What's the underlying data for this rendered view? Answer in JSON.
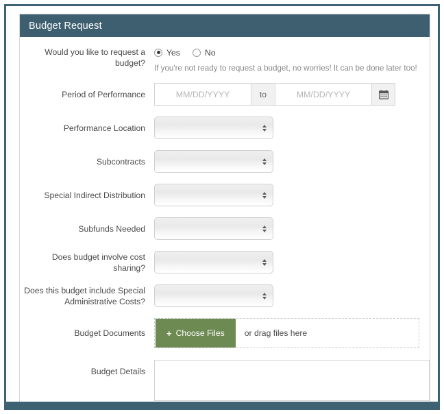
{
  "panel": {
    "title": "Budget Request"
  },
  "form": {
    "budget_request": {
      "label": "Would you like to request a budget?",
      "options": [
        {
          "label": "Yes",
          "checked": true
        },
        {
          "label": "No",
          "checked": false
        }
      ],
      "help": "If you're not ready to request a budget, no worries! It can be done later too!"
    },
    "period_of_performance": {
      "label": "Period of Performance",
      "start_value": "",
      "start_placeholder": "MM/DD/YYYY",
      "separator": "to",
      "end_value": "",
      "end_placeholder": "MM/DD/YYYY",
      "calendar_icon": "calendar-icon"
    },
    "performance_location": {
      "label": "Performance Location",
      "value": ""
    },
    "subcontracts": {
      "label": "Subcontracts",
      "value": ""
    },
    "special_indirect_distribution": {
      "label": "Special Indirect Distribution",
      "value": ""
    },
    "subfunds_needed": {
      "label": "Subfunds Needed",
      "value": ""
    },
    "cost_sharing": {
      "label": "Does budget involve cost sharing?",
      "value": ""
    },
    "special_admin_costs": {
      "label": "Does this budget include Special Administrative Costs?",
      "value": ""
    },
    "budget_documents": {
      "label": "Budget Documents",
      "choose_files_label": "Choose Files",
      "plus_icon": "plus-icon",
      "drag_text": "or drag files here"
    },
    "budget_details": {
      "label": "Budget Details",
      "value": ""
    }
  },
  "colors": {
    "frame_border": "#3f6272",
    "header_bg": "#3d5f70",
    "button_green": "#6d8a52"
  }
}
